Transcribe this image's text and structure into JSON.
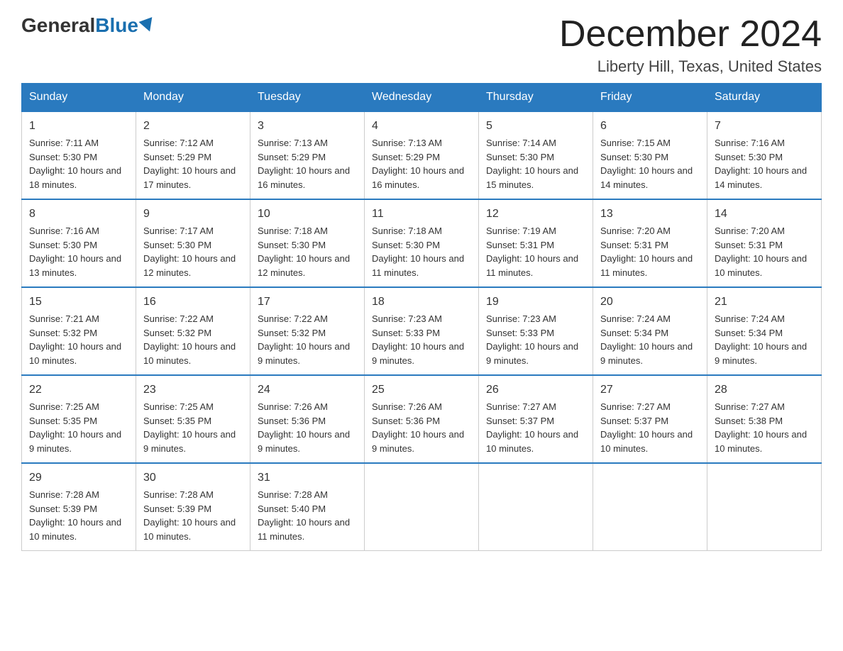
{
  "logo": {
    "general": "General",
    "blue": "Blue"
  },
  "title": "December 2024",
  "subtitle": "Liberty Hill, Texas, United States",
  "days_of_week": [
    "Sunday",
    "Monday",
    "Tuesday",
    "Wednesday",
    "Thursday",
    "Friday",
    "Saturday"
  ],
  "weeks": [
    [
      {
        "day": "1",
        "sunrise": "7:11 AM",
        "sunset": "5:30 PM",
        "daylight": "10 hours and 18 minutes."
      },
      {
        "day": "2",
        "sunrise": "7:12 AM",
        "sunset": "5:29 PM",
        "daylight": "10 hours and 17 minutes."
      },
      {
        "day": "3",
        "sunrise": "7:13 AM",
        "sunset": "5:29 PM",
        "daylight": "10 hours and 16 minutes."
      },
      {
        "day": "4",
        "sunrise": "7:13 AM",
        "sunset": "5:29 PM",
        "daylight": "10 hours and 16 minutes."
      },
      {
        "day": "5",
        "sunrise": "7:14 AM",
        "sunset": "5:30 PM",
        "daylight": "10 hours and 15 minutes."
      },
      {
        "day": "6",
        "sunrise": "7:15 AM",
        "sunset": "5:30 PM",
        "daylight": "10 hours and 14 minutes."
      },
      {
        "day": "7",
        "sunrise": "7:16 AM",
        "sunset": "5:30 PM",
        "daylight": "10 hours and 14 minutes."
      }
    ],
    [
      {
        "day": "8",
        "sunrise": "7:16 AM",
        "sunset": "5:30 PM",
        "daylight": "10 hours and 13 minutes."
      },
      {
        "day": "9",
        "sunrise": "7:17 AM",
        "sunset": "5:30 PM",
        "daylight": "10 hours and 12 minutes."
      },
      {
        "day": "10",
        "sunrise": "7:18 AM",
        "sunset": "5:30 PM",
        "daylight": "10 hours and 12 minutes."
      },
      {
        "day": "11",
        "sunrise": "7:18 AM",
        "sunset": "5:30 PM",
        "daylight": "10 hours and 11 minutes."
      },
      {
        "day": "12",
        "sunrise": "7:19 AM",
        "sunset": "5:31 PM",
        "daylight": "10 hours and 11 minutes."
      },
      {
        "day": "13",
        "sunrise": "7:20 AM",
        "sunset": "5:31 PM",
        "daylight": "10 hours and 11 minutes."
      },
      {
        "day": "14",
        "sunrise": "7:20 AM",
        "sunset": "5:31 PM",
        "daylight": "10 hours and 10 minutes."
      }
    ],
    [
      {
        "day": "15",
        "sunrise": "7:21 AM",
        "sunset": "5:32 PM",
        "daylight": "10 hours and 10 minutes."
      },
      {
        "day": "16",
        "sunrise": "7:22 AM",
        "sunset": "5:32 PM",
        "daylight": "10 hours and 10 minutes."
      },
      {
        "day": "17",
        "sunrise": "7:22 AM",
        "sunset": "5:32 PM",
        "daylight": "10 hours and 9 minutes."
      },
      {
        "day": "18",
        "sunrise": "7:23 AM",
        "sunset": "5:33 PM",
        "daylight": "10 hours and 9 minutes."
      },
      {
        "day": "19",
        "sunrise": "7:23 AM",
        "sunset": "5:33 PM",
        "daylight": "10 hours and 9 minutes."
      },
      {
        "day": "20",
        "sunrise": "7:24 AM",
        "sunset": "5:34 PM",
        "daylight": "10 hours and 9 minutes."
      },
      {
        "day": "21",
        "sunrise": "7:24 AM",
        "sunset": "5:34 PM",
        "daylight": "10 hours and 9 minutes."
      }
    ],
    [
      {
        "day": "22",
        "sunrise": "7:25 AM",
        "sunset": "5:35 PM",
        "daylight": "10 hours and 9 minutes."
      },
      {
        "day": "23",
        "sunrise": "7:25 AM",
        "sunset": "5:35 PM",
        "daylight": "10 hours and 9 minutes."
      },
      {
        "day": "24",
        "sunrise": "7:26 AM",
        "sunset": "5:36 PM",
        "daylight": "10 hours and 9 minutes."
      },
      {
        "day": "25",
        "sunrise": "7:26 AM",
        "sunset": "5:36 PM",
        "daylight": "10 hours and 9 minutes."
      },
      {
        "day": "26",
        "sunrise": "7:27 AM",
        "sunset": "5:37 PM",
        "daylight": "10 hours and 10 minutes."
      },
      {
        "day": "27",
        "sunrise": "7:27 AM",
        "sunset": "5:37 PM",
        "daylight": "10 hours and 10 minutes."
      },
      {
        "day": "28",
        "sunrise": "7:27 AM",
        "sunset": "5:38 PM",
        "daylight": "10 hours and 10 minutes."
      }
    ],
    [
      {
        "day": "29",
        "sunrise": "7:28 AM",
        "sunset": "5:39 PM",
        "daylight": "10 hours and 10 minutes."
      },
      {
        "day": "30",
        "sunrise": "7:28 AM",
        "sunset": "5:39 PM",
        "daylight": "10 hours and 10 minutes."
      },
      {
        "day": "31",
        "sunrise": "7:28 AM",
        "sunset": "5:40 PM",
        "daylight": "10 hours and 11 minutes."
      },
      null,
      null,
      null,
      null
    ]
  ],
  "labels": {
    "sunrise": "Sunrise:",
    "sunset": "Sunset:",
    "daylight": "Daylight:"
  }
}
